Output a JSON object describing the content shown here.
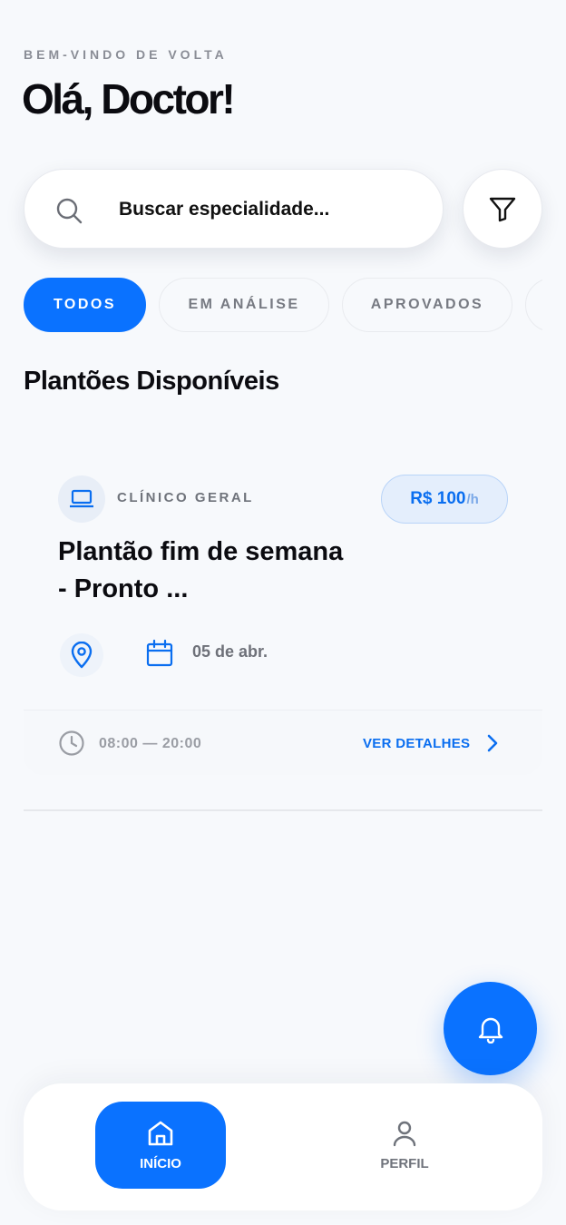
{
  "header": {
    "eyebrow": "BEM-VINDO DE VOLTA",
    "greeting": "Olá, Doctor!"
  },
  "search": {
    "placeholder": "Buscar especialidade...",
    "value": ""
  },
  "chips": [
    {
      "label": "TODOS",
      "active": true
    },
    {
      "label": "EM ANÁLISE",
      "active": false
    },
    {
      "label": "APROVADOS",
      "active": false
    }
  ],
  "section_title": "Plantões Disponíveis",
  "card": {
    "category": "CLÍNICO GERAL",
    "price_amount": "R$ 100",
    "price_unit": "/h",
    "title": "Plantão fim de semana - Pronto ...",
    "date": "05 de abr.",
    "hours": "08:00 — 20:00",
    "details_label": "VER DETALHES"
  },
  "nav": {
    "home_label": "INÍCIO",
    "profile_label": "PERFIL"
  },
  "colors": {
    "accent": "#0a72ff",
    "background": "#f7f9fc"
  }
}
